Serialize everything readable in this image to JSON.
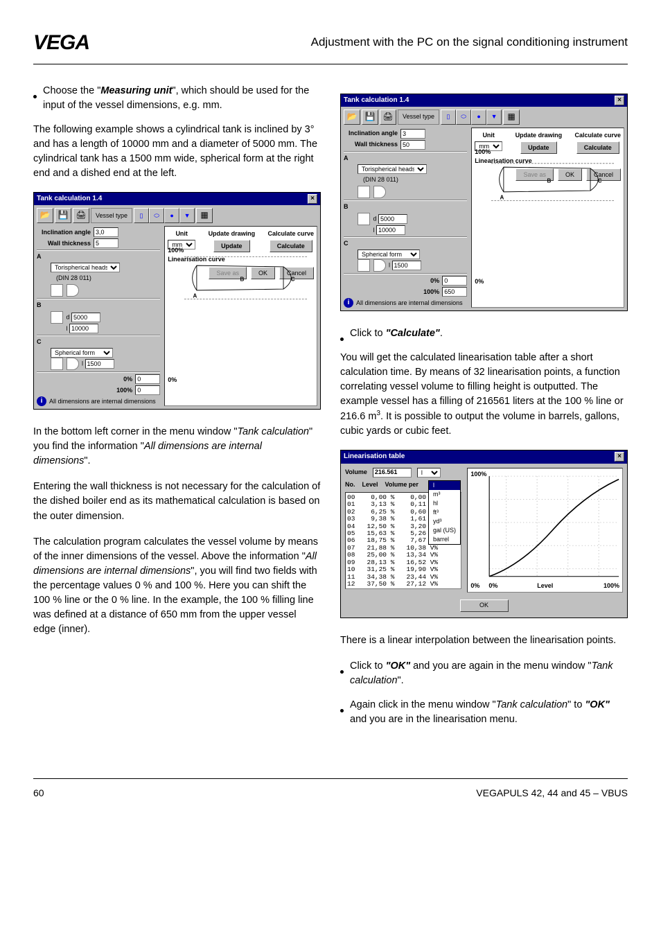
{
  "header": {
    "logo": "VEGA",
    "title": "Adjustment with the PC on the signal conditioning instrument"
  },
  "left": {
    "bullet1_prefix": "Choose the \"",
    "bullet1_em": "Measuring unit",
    "bullet1_suffix": "\", which should be used for the input of the vessel dimensions, e.g. mm.",
    "p1": "The following example shows a cylindrical tank is inclined by 3° and has a length of 10000 mm and a diameter of 5000 mm. The cylindrical tank has a 1500 mm wide, spherical form at the right end and a dished end at the left.",
    "p2_a": "In the bottom left corner in the menu window \"",
    "p2_em1": "Tank calculation",
    "p2_b": "\" you find the information \"",
    "p2_em2": "All dimensions are internal dimensions",
    "p2_c": "\".",
    "p3": "Entering the wall thickness is not necessary for the calculation of the dished boiler end as its mathematical calculation is based on the outer dimension.",
    "p4_a": "The calculation program calculates the vessel volume by means of the inner dimensions of the vessel. Above the information \"",
    "p4_em": "All dimensions are internal dimensions",
    "p4_b": "\", you will find two fields with the percentage values 0 % and 100 %. Here you can shift the 100 % line or the 0 % line. In the example, the 100 % filling line was defined at a distance of 650 mm from the upper vessel edge (inner)."
  },
  "right": {
    "bullet_calc_a": "Click to ",
    "bullet_calc_b": "\"Calculate\"",
    "bullet_calc_c": ".",
    "p1_a": "You will get the calculated linearisation table after a short calculation time. By means of 32 linearisation points, a function correlating vessel volume to filling height is outputted. The example vessel has a filling of 216561 liters at the 100 % line or 216.6 m",
    "p1_sup": "3",
    "p1_b": ". It is possible to output the volume in barrels, gallons, cubic yards or cubic feet.",
    "p2": "There is a linear interpolation between the linearisation points.",
    "b_ok1_a": "Click to ",
    "b_ok1_b": "\"OK\"",
    "b_ok1_c": " and you are again in the menu window \"",
    "b_ok1_em": "Tank calculation",
    "b_ok1_d": "\".",
    "b_ok2_a": "Again click in the menu window \"",
    "b_ok2_em": "Tank calculation",
    "b_ok2_b": "\" to ",
    "b_ok2_c": "\"OK\"",
    "b_ok2_d": " and you are in the linearisation menu."
  },
  "dlg1": {
    "title": "Tank calculation 1.4",
    "vessel_type": "Vessel type",
    "inc_label": "Inclination angle",
    "inc_val": "3,0",
    "wall_label": "Wall thickness",
    "wall_val": "5",
    "unit_label": "Unit",
    "unit_val": "mm",
    "upd_label": "Update drawing",
    "upd_btn": "Update",
    "calc_label": "Calculate curve",
    "calc_btn": "Calculate",
    "secA": "A",
    "a_sel": "Torispherical heads",
    "a_note": "(DIN 28 011)",
    "secB": "B",
    "b_d_lab": "d",
    "b_d": "5000",
    "b_l_lab": "l",
    "b_l": "10000",
    "secC": "C",
    "c_sel": "Spherical form",
    "c_l_lab": "l",
    "c_l": "1500",
    "zero_lab": "0%",
    "zero_val": "0",
    "hund_lab": "100%",
    "hund_val": "0",
    "info": "All dimensions are internal dimensions",
    "lin_curve": "Linearisation curve",
    "save_as": "Save as",
    "ok": "OK",
    "cancel": "Cancel",
    "mark100": "100%",
    "mark0": "0%",
    "markA": "A",
    "markB": "B",
    "markC": "C"
  },
  "dlg2": {
    "title": "Tank calculation 1.4",
    "inc_val": "3",
    "wall_val": "50",
    "b_d": "5000",
    "b_l": "10000",
    "c_l": "1500",
    "zero_val": "0",
    "hund_val": "650"
  },
  "dlg3": {
    "title": "Linearisation table",
    "vol_label": "Volume",
    "vol_val": "216.561",
    "vol_unit_sel": "l",
    "units": [
      "l",
      "m³",
      "hl",
      "ft³",
      "yd³",
      "gal (US)",
      "barrel"
    ],
    "col_no": "No.",
    "col_level": "Level",
    "col_vp": "Volume per",
    "rows": [
      [
        "00",
        "0,00 %",
        "0,00 V%"
      ],
      [
        "01",
        "3,13 %",
        "0,11 V%"
      ],
      [
        "02",
        "6,25 %",
        "0,60 V%"
      ],
      [
        "03",
        "9,38 %",
        "1,61 V%"
      ],
      [
        "04",
        "12,50 %",
        "3,20 V%"
      ],
      [
        "05",
        "15,63 %",
        "5,26 V%"
      ],
      [
        "06",
        "18,75 %",
        "7,67 V%"
      ],
      [
        "07",
        "21,88 %",
        "10,38 V%"
      ],
      [
        "08",
        "25,00 %",
        "13,34 V%"
      ],
      [
        "09",
        "28,13 %",
        "16,52 V%"
      ],
      [
        "10",
        "31,25 %",
        "19,90 V%"
      ],
      [
        "11",
        "34,38 %",
        "23,44 V%"
      ],
      [
        "12",
        "37,50 %",
        "27,12 V%"
      ]
    ],
    "ax100": "100%",
    "ax0": "0%",
    "axLevel": "Level",
    "ok": "OK"
  },
  "footer": {
    "page": "60",
    "doc": "VEGAPULS 42, 44 and 45 – VBUS"
  }
}
